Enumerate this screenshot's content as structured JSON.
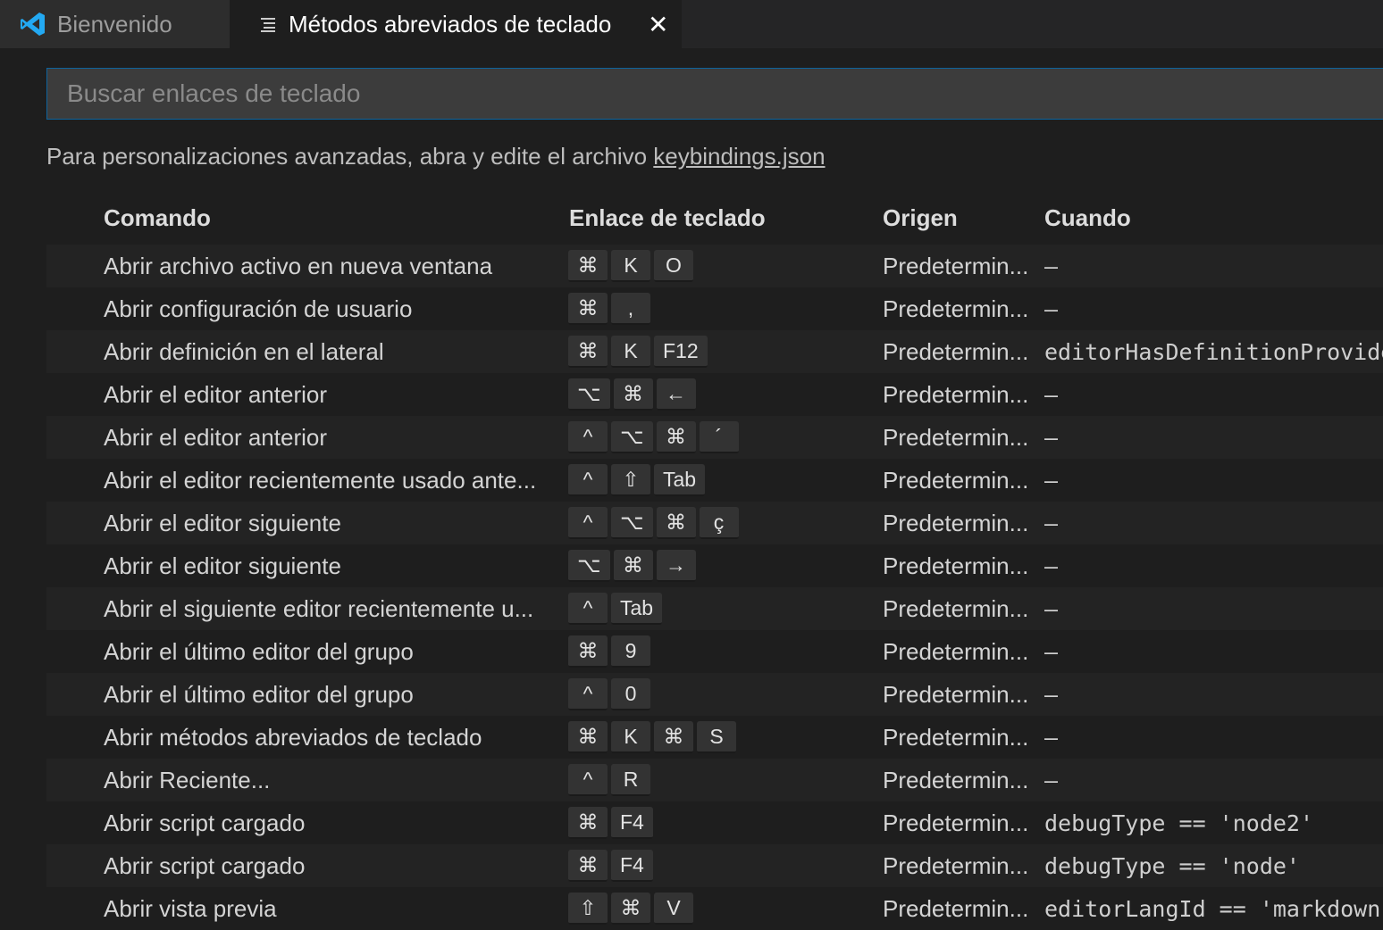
{
  "tabs": {
    "welcome": {
      "label": "Bienvenido",
      "icon": "vscode-logo-icon"
    },
    "keybindings": {
      "label": "Métodos abreviados de teclado",
      "icon": "preview-lines-icon",
      "close": "✕"
    }
  },
  "search": {
    "placeholder": "Buscar enlaces de teclado",
    "value": ""
  },
  "hint": {
    "text": "Para personalizaciones avanzadas, abra y edite el archivo ",
    "link": "keybindings.json"
  },
  "columns": {
    "command": "Comando",
    "keybinding": "Enlace de teclado",
    "source": "Origen",
    "when": "Cuando"
  },
  "colors": {
    "accent": "#0e639c",
    "vscode_blue": "#23a9f2"
  },
  "rows": [
    {
      "command": "Abrir archivo activo en nueva ventana",
      "keys": [
        "⌘",
        "K",
        "O"
      ],
      "source": "Predetermin...",
      "when": "—"
    },
    {
      "command": "Abrir configuración de usuario",
      "keys": [
        "⌘",
        ","
      ],
      "source": "Predetermin...",
      "when": "—"
    },
    {
      "command": "Abrir definición en el lateral",
      "keys": [
        "⌘",
        "K",
        "F12"
      ],
      "source": "Predetermin...",
      "when": "editorHasDefinitionProvider"
    },
    {
      "command": "Abrir el editor anterior",
      "keys": [
        "⌥",
        "⌘",
        "←"
      ],
      "source": "Predetermin...",
      "when": "—"
    },
    {
      "command": "Abrir el editor anterior",
      "keys": [
        "^",
        "⌥",
        "⌘",
        "´"
      ],
      "source": "Predetermin...",
      "when": "—"
    },
    {
      "command": "Abrir el editor recientemente usado ante...",
      "keys": [
        "^",
        "⇧",
        "Tab"
      ],
      "source": "Predetermin...",
      "when": "—"
    },
    {
      "command": "Abrir el editor siguiente",
      "keys": [
        "^",
        "⌥",
        "⌘",
        "ç"
      ],
      "source": "Predetermin...",
      "when": "—"
    },
    {
      "command": "Abrir el editor siguiente",
      "keys": [
        "⌥",
        "⌘",
        "→"
      ],
      "source": "Predetermin...",
      "when": "—"
    },
    {
      "command": "Abrir el siguiente editor recientemente u...",
      "keys": [
        "^",
        "Tab"
      ],
      "source": "Predetermin...",
      "when": "—"
    },
    {
      "command": "Abrir el último editor del grupo",
      "keys": [
        "⌘",
        "9"
      ],
      "source": "Predetermin...",
      "when": "—"
    },
    {
      "command": "Abrir el último editor del grupo",
      "keys": [
        "^",
        "0"
      ],
      "source": "Predetermin...",
      "when": "—"
    },
    {
      "command": "Abrir métodos abreviados de teclado",
      "keys": [
        "⌘",
        "K",
        "⌘",
        "S"
      ],
      "source": "Predetermin...",
      "when": "—"
    },
    {
      "command": "Abrir Reciente...",
      "keys": [
        "^",
        "R"
      ],
      "source": "Predetermin...",
      "when": "—"
    },
    {
      "command": "Abrir script cargado",
      "keys": [
        "⌘",
        "F4"
      ],
      "source": "Predetermin...",
      "when": "debugType == 'node2'"
    },
    {
      "command": "Abrir script cargado",
      "keys": [
        "⌘",
        "F4"
      ],
      "source": "Predetermin...",
      "when": "debugType == 'node'"
    },
    {
      "command": "Abrir vista previa",
      "keys": [
        "⇧",
        "⌘",
        "V"
      ],
      "source": "Predetermin...",
      "when": "editorLangId == 'markdown'"
    }
  ]
}
